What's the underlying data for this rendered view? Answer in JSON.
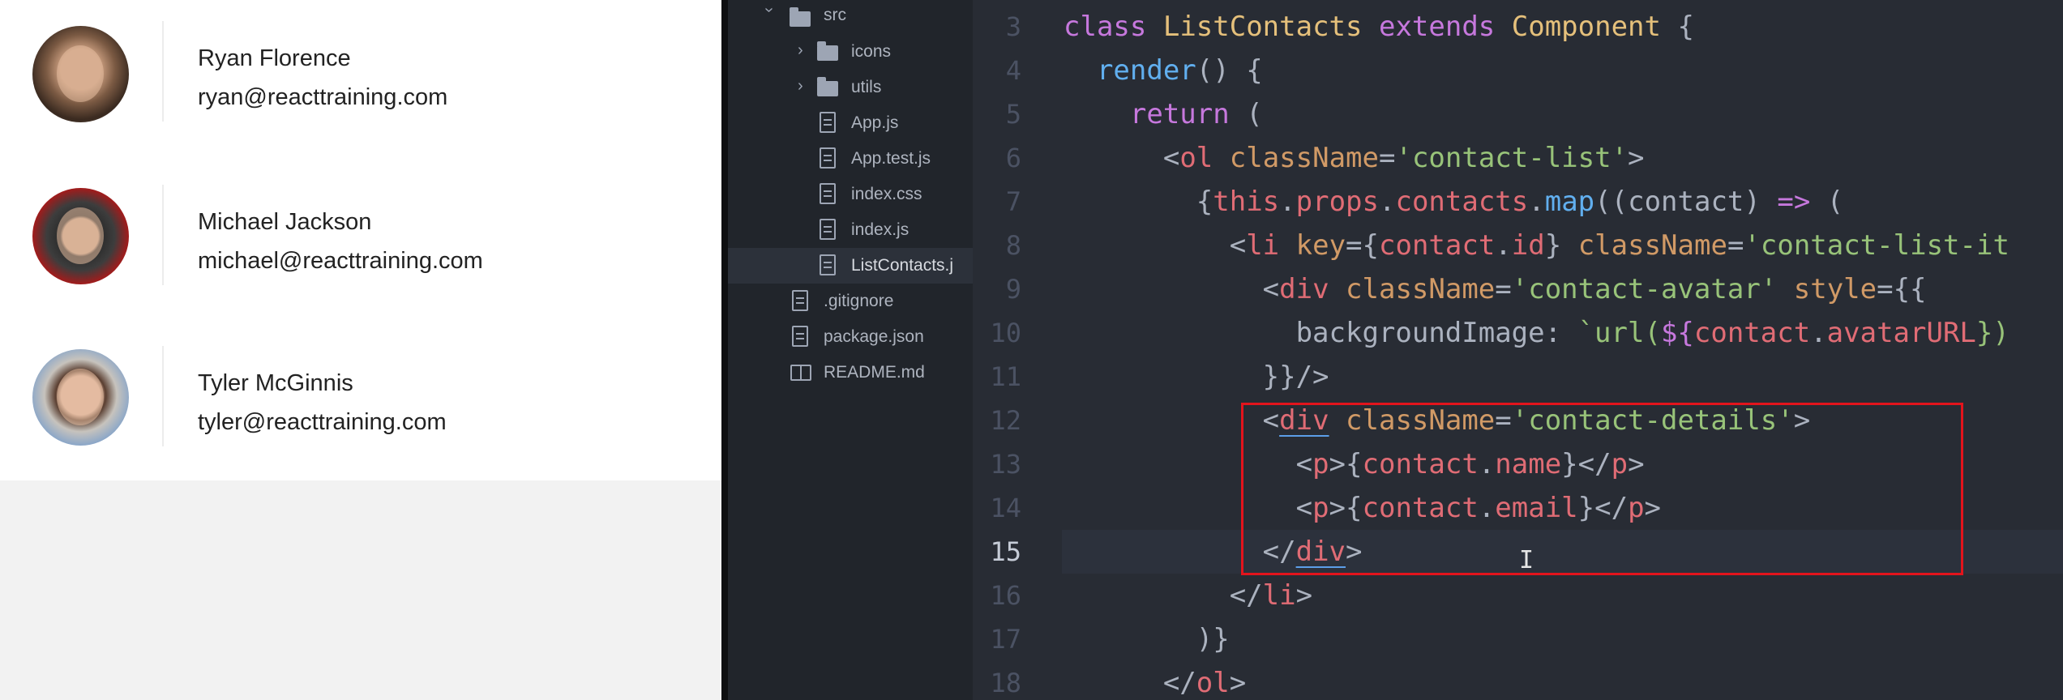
{
  "contacts": [
    {
      "name": "Ryan Florence",
      "email": "ryan@reacttraining.com",
      "avatar_icon": "ryan-avatar-photo"
    },
    {
      "name": "Michael Jackson",
      "email": "michael@reacttraining.com",
      "avatar_icon": "michael-avatar-photo"
    },
    {
      "name": "Tyler McGinnis",
      "email": "tyler@reacttraining.com",
      "avatar_icon": "tyler-avatar-photo"
    }
  ],
  "file_tree": [
    {
      "label": "src",
      "type": "folder",
      "expanded": true,
      "icon": "folder-icon",
      "chevron": "chevron-down-icon"
    },
    {
      "label": "icons",
      "type": "folder",
      "expanded": false,
      "icon": "folder-icon",
      "chevron": "chevron-right-icon"
    },
    {
      "label": "utils",
      "type": "folder",
      "expanded": false,
      "icon": "folder-icon",
      "chevron": "chevron-right-icon"
    },
    {
      "label": "App.js",
      "type": "file",
      "icon": "file-icon"
    },
    {
      "label": "App.test.js",
      "type": "file",
      "icon": "file-icon"
    },
    {
      "label": "index.css",
      "type": "file",
      "icon": "file-icon"
    },
    {
      "label": "index.js",
      "type": "file",
      "icon": "file-icon"
    },
    {
      "label": "ListContacts.j",
      "type": "file",
      "icon": "file-icon",
      "selected": true
    },
    {
      "label": ".gitignore",
      "type": "file",
      "icon": "file-icon"
    },
    {
      "label": "package.json",
      "type": "file",
      "icon": "file-icon"
    },
    {
      "label": "README.md",
      "type": "file",
      "icon": "book-icon"
    }
  ],
  "editor": {
    "current_line": "15",
    "line_numbers": [
      "3",
      "4",
      "5",
      "6",
      "7",
      "8",
      "9",
      "10",
      "11",
      "12",
      "13",
      "14",
      "15",
      "16",
      "17",
      "18"
    ],
    "code": {
      "l3": [
        "class",
        "ListContacts",
        "extends",
        "Component",
        "{"
      ],
      "l4": [
        "render",
        "() {"
      ],
      "l5": [
        "return",
        "("
      ],
      "l6": [
        "<",
        "ol",
        "className",
        "=",
        "'contact-list'",
        ">"
      ],
      "l7": [
        "{",
        "this",
        ".",
        "props",
        ".",
        "contacts",
        ".",
        "map",
        "((",
        "contact",
        ") ",
        "=>",
        " ("
      ],
      "l8": [
        "<",
        "li",
        "key",
        "={",
        "contact",
        ".",
        "id",
        "}",
        "className",
        "=",
        "'contact-list-it"
      ],
      "l9": [
        "<",
        "div",
        "className",
        "=",
        "'contact-avatar'",
        "style",
        "={{"
      ],
      "l10": [
        "backgroundImage",
        ": ",
        "`url(",
        "${",
        "contact",
        ".",
        "avatarURL",
        "})"
      ],
      "l11": [
        "}}/>"
      ],
      "l12": [
        "<",
        "div",
        "className",
        "=",
        "'contact-details'",
        ">"
      ],
      "l13": [
        "<",
        "p",
        ">{",
        "contact",
        ".",
        "name",
        "}</",
        "p",
        ">"
      ],
      "l14": [
        "<",
        "p",
        ">{",
        "contact",
        ".",
        "email",
        "}</",
        "p",
        ">"
      ],
      "l15": [
        "</",
        "div",
        ">"
      ],
      "l16": [
        "</",
        "li",
        ">"
      ],
      "l17": [
        ")}"
      ],
      "l18": [
        "</",
        "ol",
        ">"
      ]
    },
    "cursor_glyph": "I"
  },
  "colors": {
    "keyword": "#c678dd",
    "class_name": "#e5c07b",
    "function": "#61afef",
    "tag": "#e06c75",
    "attribute": "#d19a66",
    "string": "#98c379",
    "highlight_box": "#e3141c"
  }
}
